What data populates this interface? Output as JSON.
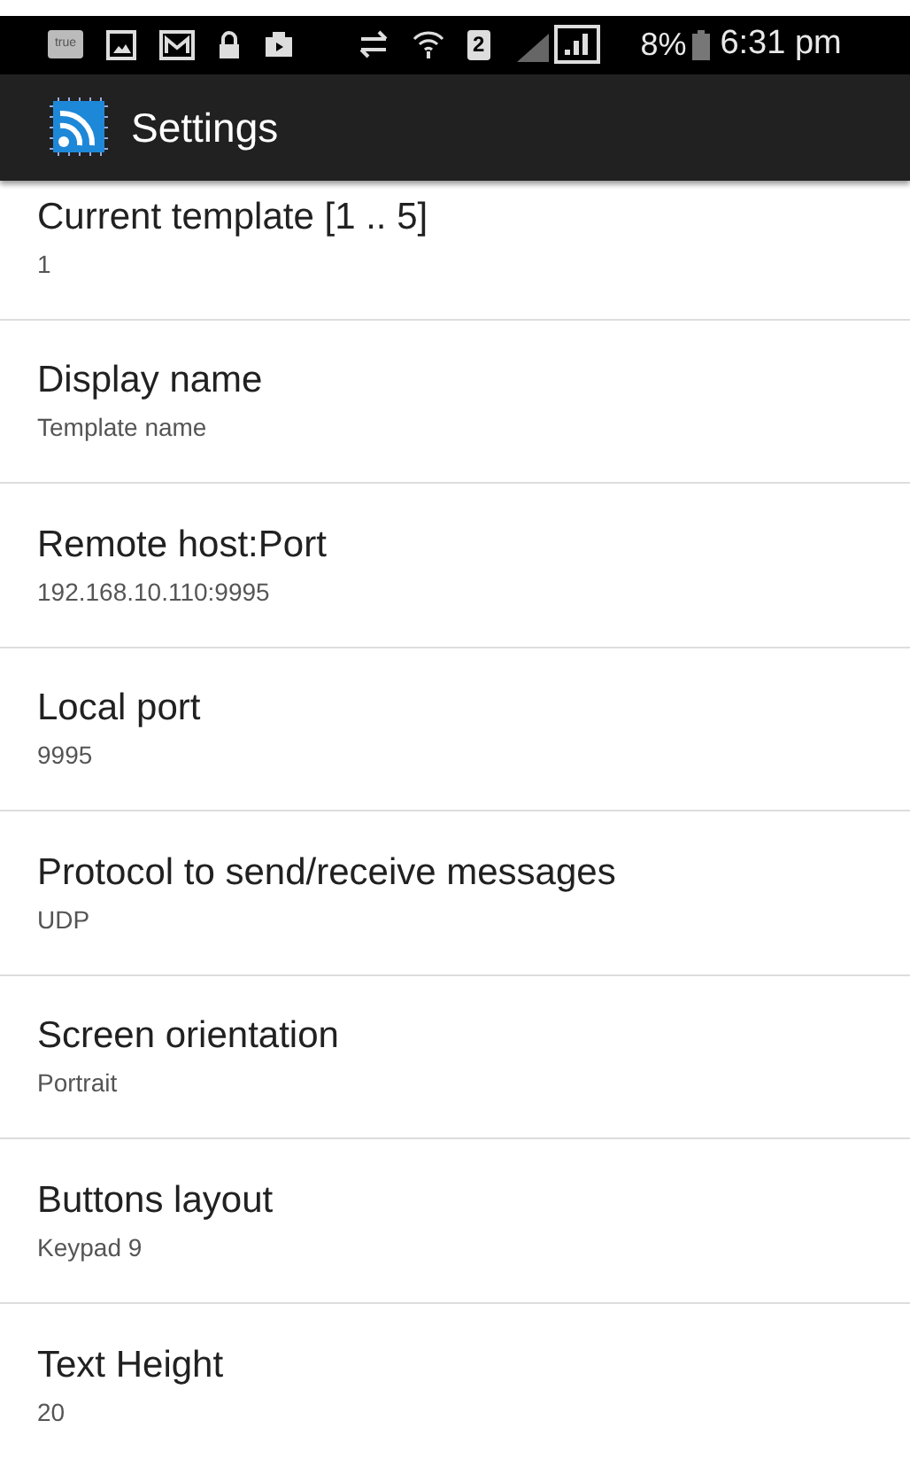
{
  "status_bar": {
    "carrier_badge": "true",
    "sim_badge": "2",
    "battery": "8%",
    "time": "6:31 pm"
  },
  "app_bar": {
    "title": "Settings"
  },
  "preferences": [
    {
      "title": "Current template [1 .. 5]",
      "summary": "1"
    },
    {
      "title": "Display name",
      "summary": "Template name"
    },
    {
      "title": "Remote host:Port",
      "summary": "192.168.10.110:9995"
    },
    {
      "title": "Local port",
      "summary": "9995"
    },
    {
      "title": "Protocol to send/receive messages",
      "summary": "UDP"
    },
    {
      "title": "Screen orientation",
      "summary": "Portrait"
    },
    {
      "title": "Buttons layout",
      "summary": "Keypad 9"
    },
    {
      "title": "Text Height",
      "summary": "20"
    }
  ]
}
